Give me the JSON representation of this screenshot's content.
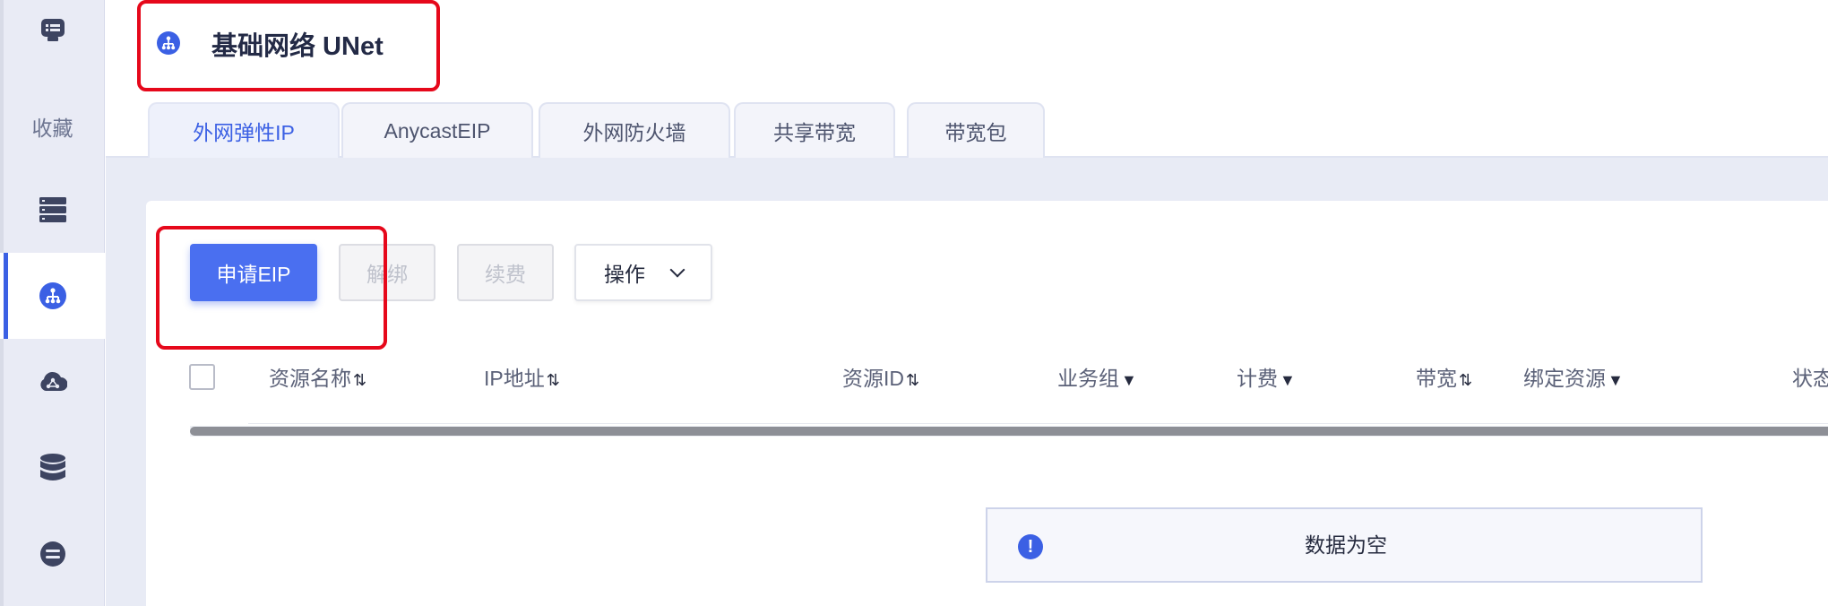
{
  "sidebar": {
    "items": [
      {
        "icon": "console-icon"
      },
      {
        "label": "收藏"
      },
      {
        "icon": "server-list-icon"
      },
      {
        "icon": "network-icon",
        "active": true
      },
      {
        "icon": "cloud-icon"
      },
      {
        "icon": "database-icon"
      },
      {
        "icon": "storage-icon"
      }
    ]
  },
  "header": {
    "title": "基础网络 UNet",
    "title_icon": "network-icon"
  },
  "tabs": [
    {
      "label": "外网弹性IP",
      "active": true
    },
    {
      "label": "AnycastEIP"
    },
    {
      "label": "外网防火墙"
    },
    {
      "label": "共享带宽"
    },
    {
      "label": "带宽包"
    }
  ],
  "toolbar": {
    "apply_label": "申请EIP",
    "unbind_label": "解绑",
    "renew_label": "续费",
    "ops_label": "操作"
  },
  "table": {
    "columns": [
      {
        "label": "资源名称",
        "indicator": "⇅"
      },
      {
        "label": "IP地址",
        "indicator": "⇅"
      },
      {
        "label": "资源ID",
        "indicator": "⇅"
      },
      {
        "label": "业务组",
        "indicator": "▼"
      },
      {
        "label": "计费",
        "indicator": "▼"
      },
      {
        "label": "带宽",
        "indicator": "⇅"
      },
      {
        "label": "绑定资源",
        "indicator": "▼"
      },
      {
        "label": "状态",
        "indicator": ""
      }
    ],
    "empty_text": "数据为空"
  },
  "colors": {
    "accent": "#3b60e4",
    "highlight": "#e6081b",
    "sidebar_bg": "#e9ebf5"
  }
}
